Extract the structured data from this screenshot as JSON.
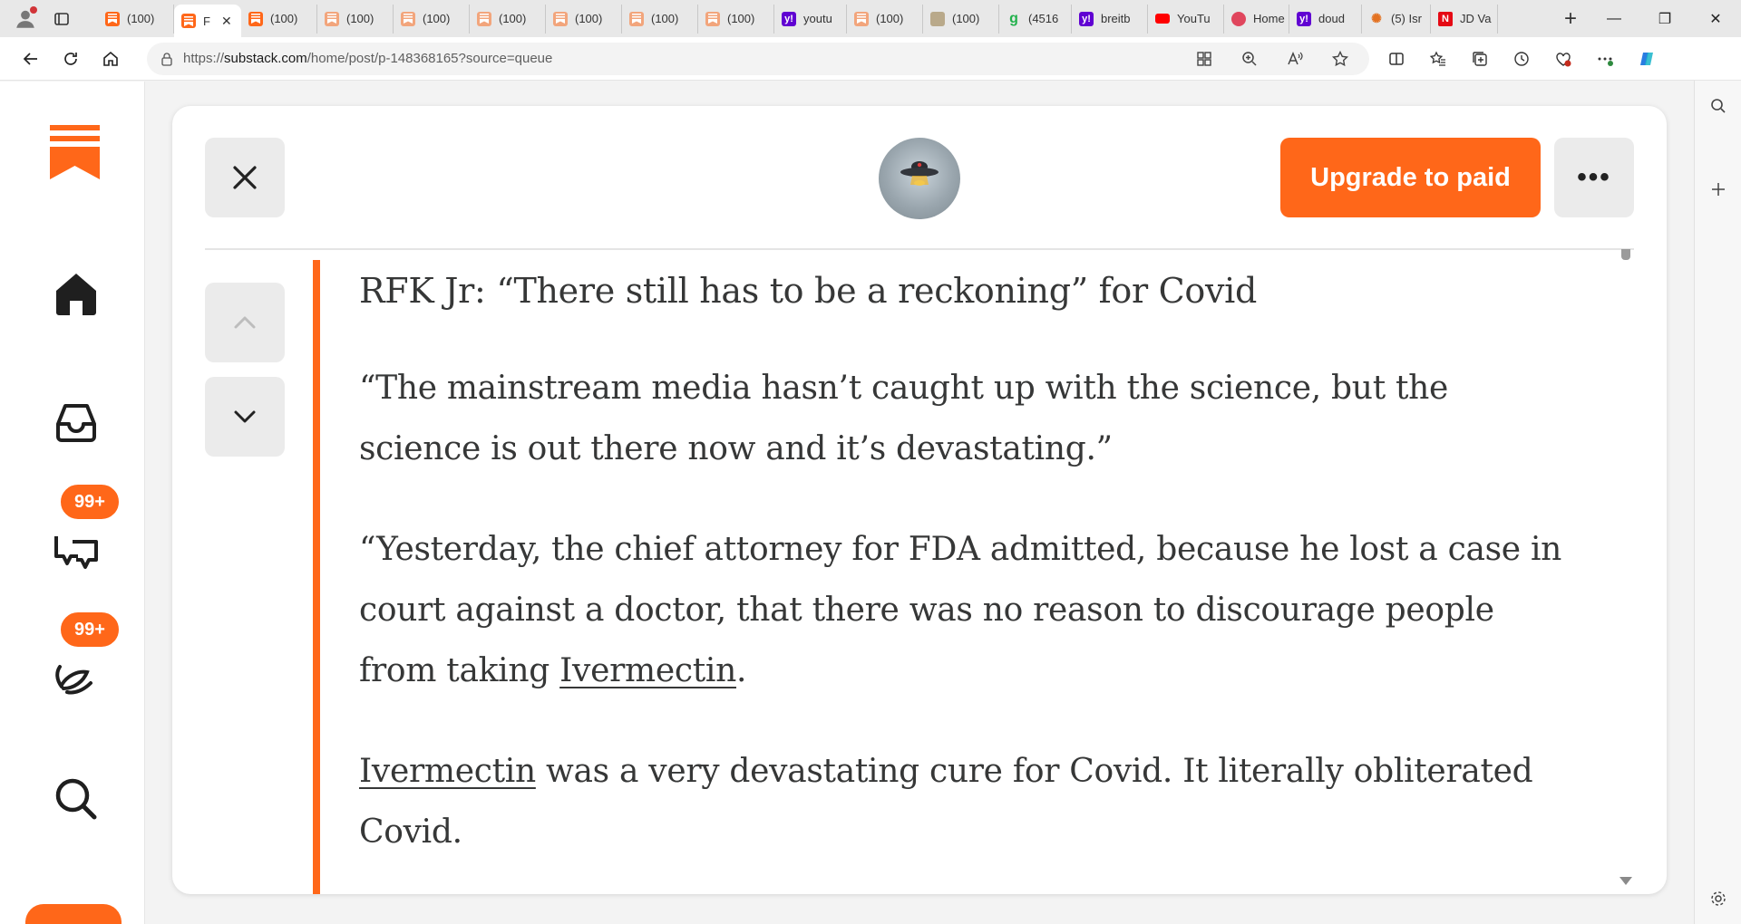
{
  "browser": {
    "tabs": [
      {
        "favicon": "substack",
        "title": "(100)"
      },
      {
        "favicon": "substack",
        "title": "F",
        "active": true
      },
      {
        "favicon": "substack",
        "title": "(100)"
      },
      {
        "favicon": "substack-faded",
        "title": "(100)"
      },
      {
        "favicon": "substack-faded",
        "title": "(100)"
      },
      {
        "favicon": "substack-faded",
        "title": "(100)"
      },
      {
        "favicon": "substack-faded",
        "title": "(100)"
      },
      {
        "favicon": "substack-faded",
        "title": "(100)"
      },
      {
        "favicon": "substack-faded",
        "title": "(100)"
      },
      {
        "favicon": "yahoo",
        "title": "youtu"
      },
      {
        "favicon": "substack-faded",
        "title": "(100)"
      },
      {
        "favicon": "image",
        "title": "(100)"
      },
      {
        "favicon": "green-g",
        "title": "(4516"
      },
      {
        "favicon": "yahoo",
        "title": "breitb"
      },
      {
        "favicon": "youtube",
        "title": "YouTu"
      },
      {
        "favicon": "podcast",
        "title": "Home"
      },
      {
        "favicon": "yahoo",
        "title": "doud"
      },
      {
        "favicon": "nbc",
        "title": "(5) Isr"
      },
      {
        "favicon": "n-red",
        "title": "JD Va"
      }
    ],
    "url_prefix": "https://",
    "url_domain": "substack.com",
    "url_path": "/home/post/p-148368165?source=queue"
  },
  "substack_nav": {
    "items": [
      {
        "name": "home",
        "icon": "home-icon"
      },
      {
        "name": "inbox",
        "icon": "inbox-icon"
      },
      {
        "name": "chat",
        "icon": "chat-icon",
        "badge": "99+"
      },
      {
        "name": "activity",
        "icon": "activity-icon",
        "badge": "99+"
      },
      {
        "name": "search",
        "icon": "search-icon"
      }
    ]
  },
  "post_header": {
    "upgrade_label": "Upgrade to paid",
    "more_label": "•••"
  },
  "article": {
    "title": "RFK Jr: “There still has to be a reckoning” for Covid",
    "p1": "“The mainstream media hasn’t caught up with the science, but the science is out there now and it’s devastating.”",
    "p2_before": "“Yesterday, the chief attorney for FDA admitted, because he lost a case in court against a doctor, that there was no reason to discourage people from taking ",
    "p2_link": "Ivermectin",
    "p2_after": ".",
    "p3_link": "Ivermectin",
    "p3_after": " was a very devastating cure for Covid. It literally obliterated Covid."
  },
  "colors": {
    "brand": "#ff6719",
    "text": "#363737"
  }
}
